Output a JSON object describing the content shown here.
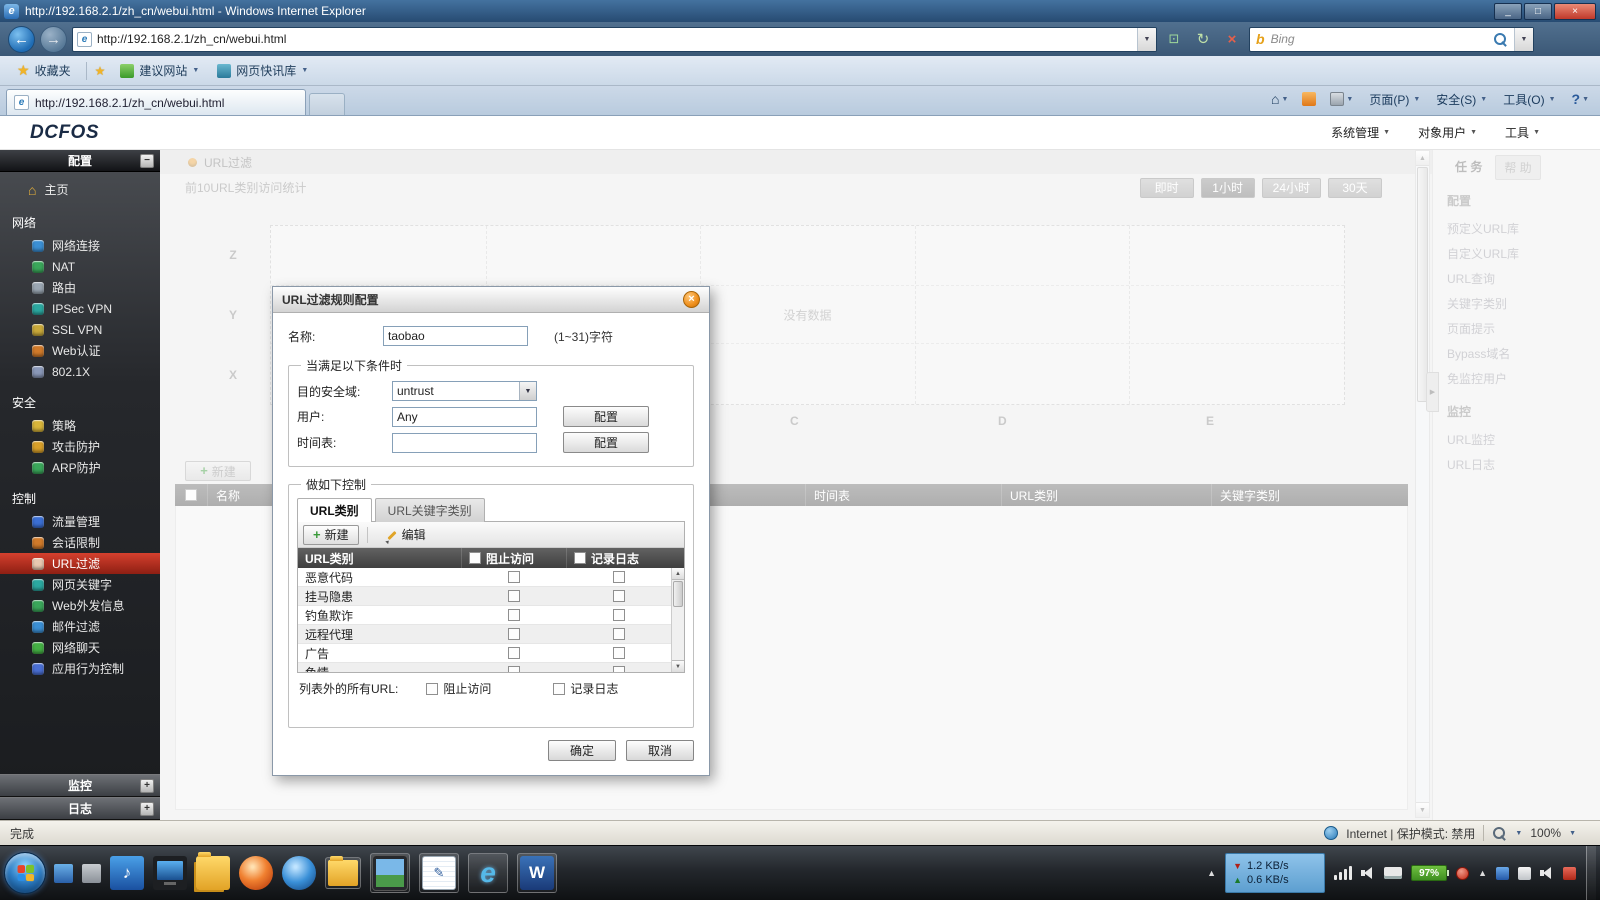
{
  "browser": {
    "window_title": "http://192.168.2.1/zh_cn/webui.html - Windows Internet Explorer",
    "address": "http://192.168.2.1/zh_cn/webui.html",
    "search_label": "Bing",
    "favbar": {
      "fav_button": "收藏夹",
      "items": [
        {
          "label": "建议网站",
          "icon": "suggested-sites"
        },
        {
          "label": "网页快讯库",
          "icon": "web-slices"
        }
      ]
    },
    "tab_title": "http://192.168.2.1/zh_cn/webui.html",
    "command_buttons": [
      "页面(P)",
      "安全(S)",
      "工具(O)"
    ],
    "status": {
      "left": "完成",
      "zone": "Internet | 保护模式: 禁用",
      "zoom": "100%"
    }
  },
  "app": {
    "logo": "DCFOS",
    "menus": [
      "系统管理",
      "对象用户",
      "工具"
    ],
    "sidebar": {
      "header": "配置",
      "home": "主页",
      "sections": [
        {
          "label": "网络",
          "items": [
            {
              "label": "网络连接",
              "icon": "network-connection",
              "color": "#3b8fd4"
            },
            {
              "label": "NAT",
              "icon": "nat",
              "color": "#3aa65a"
            },
            {
              "label": "路由",
              "icon": "route",
              "color": "#9aa6b2"
            },
            {
              "label": "IPSec VPN",
              "icon": "ipsec-vpn",
              "color": "#2ba8a0"
            },
            {
              "label": "SSL VPN",
              "icon": "ssl-vpn",
              "color": "#c9a93a"
            },
            {
              "label": "Web认证",
              "icon": "web-auth",
              "color": "#d07a2a"
            },
            {
              "label": "802.1X",
              "icon": "dot1x",
              "color": "#8a98b8"
            }
          ]
        },
        {
          "label": "安全",
          "items": [
            {
              "label": "策略",
              "icon": "policy",
              "color": "#d9b53a"
            },
            {
              "label": "攻击防护",
              "icon": "attack-defense",
              "color": "#d9a02a"
            },
            {
              "label": "ARP防护",
              "icon": "arp-defense",
              "color": "#3aa65a"
            }
          ]
        },
        {
          "label": "控制",
          "items": [
            {
              "label": "流量管理",
              "icon": "traffic-management",
              "color": "#3b6fd4"
            },
            {
              "label": "会话限制",
              "icon": "session-limit",
              "color": "#d07a2a"
            },
            {
              "label": "URL过滤",
              "icon": "url-filter",
              "color": "#e8c8b0",
              "selected": true
            },
            {
              "label": "网页关键字",
              "icon": "web-keyword",
              "color": "#2ba8a0"
            },
            {
              "label": "Web外发信息",
              "icon": "web-outgoing",
              "color": "#3aa65a"
            },
            {
              "label": "邮件过滤",
              "icon": "mail-filter",
              "color": "#3b8fd4"
            },
            {
              "label": "网络聊天",
              "icon": "network-chat",
              "color": "#44b044"
            },
            {
              "label": "应用行为控制",
              "icon": "app-behavior",
              "color": "#4a6fd4"
            }
          ]
        }
      ],
      "bottom": [
        "监控",
        "日志"
      ]
    },
    "content": {
      "title": "URL过滤",
      "chart_heading": "前10URL类别访问统计",
      "time_filters": [
        "即时",
        "1小时",
        "24小时",
        "30天"
      ],
      "time_selected": "1小时",
      "empty_text": "没有数据",
      "new_button": "新建",
      "table_columns": [
        "名称",
        "时间表",
        "URL类别",
        "关键字类别"
      ],
      "y_ticks": [
        "Z",
        "Y",
        "X"
      ],
      "x_ticks": [
        "C",
        "D",
        "E"
      ]
    },
    "tasks_panel": {
      "tabs": [
        "任 务",
        "帮 助"
      ],
      "sections": [
        {
          "title": "配置",
          "items": [
            "预定义URL库",
            "自定义URL库",
            "URL查询",
            "关键字类别",
            "页面提示",
            "Bypass域名",
            "免监控用户"
          ]
        },
        {
          "title": "监控",
          "items": [
            "URL监控",
            "URL日志"
          ]
        }
      ]
    }
  },
  "chart_data": {
    "type": "bar",
    "title": "前10URL类别访问统计",
    "categories": [],
    "values": [],
    "note": "没有数据",
    "visible_x_ticks": [
      "C",
      "D",
      "E"
    ],
    "visible_y_ticks": [
      "Z",
      "Y",
      "X"
    ]
  },
  "dialog": {
    "title": "URL过滤规则配置",
    "fields": {
      "name_label": "名称:",
      "name_value": "taobao",
      "name_hint": "(1~31)字符",
      "zone_label": "目的安全域:",
      "zone_value": "untrust",
      "user_label": "用户:",
      "user_value": "Any",
      "schedule_label": "时间表:",
      "schedule_value": "",
      "config_button": "配置"
    },
    "condition_legend": "当满足以下条件时",
    "control_legend": "做如下控制",
    "tabs": [
      "URL类别",
      "URL关键字类别"
    ],
    "active_tab": "URL类别",
    "toolbar": {
      "new": "新建",
      "edit": "编辑"
    },
    "grid": {
      "columns": [
        "URL类别",
        "阻止访问",
        "记录日志"
      ],
      "rows": [
        {
          "category": "恶意代码",
          "block": false,
          "log": false
        },
        {
          "category": "挂马隐患",
          "block": false,
          "log": false
        },
        {
          "category": "钓鱼欺诈",
          "block": false,
          "log": false
        },
        {
          "category": "远程代理",
          "block": false,
          "log": false
        },
        {
          "category": "广告",
          "block": false,
          "log": false
        },
        {
          "category": "色情",
          "block": false,
          "log": false
        }
      ]
    },
    "footer": {
      "label": "列表外的所有URL:",
      "options": [
        "阻止访问",
        "记录日志"
      ]
    },
    "buttons": {
      "ok": "确定",
      "cancel": "取消"
    }
  },
  "taskbar": {
    "net_down": "1.2 KB/s",
    "net_up": "0.6 KB/s",
    "battery": "97%"
  },
  "colors": {
    "sidebar_selected": "#c03428",
    "dialog_close": "#ef8f1c",
    "accent_orange": "#e8a33d",
    "titlebar": "#35587f"
  }
}
